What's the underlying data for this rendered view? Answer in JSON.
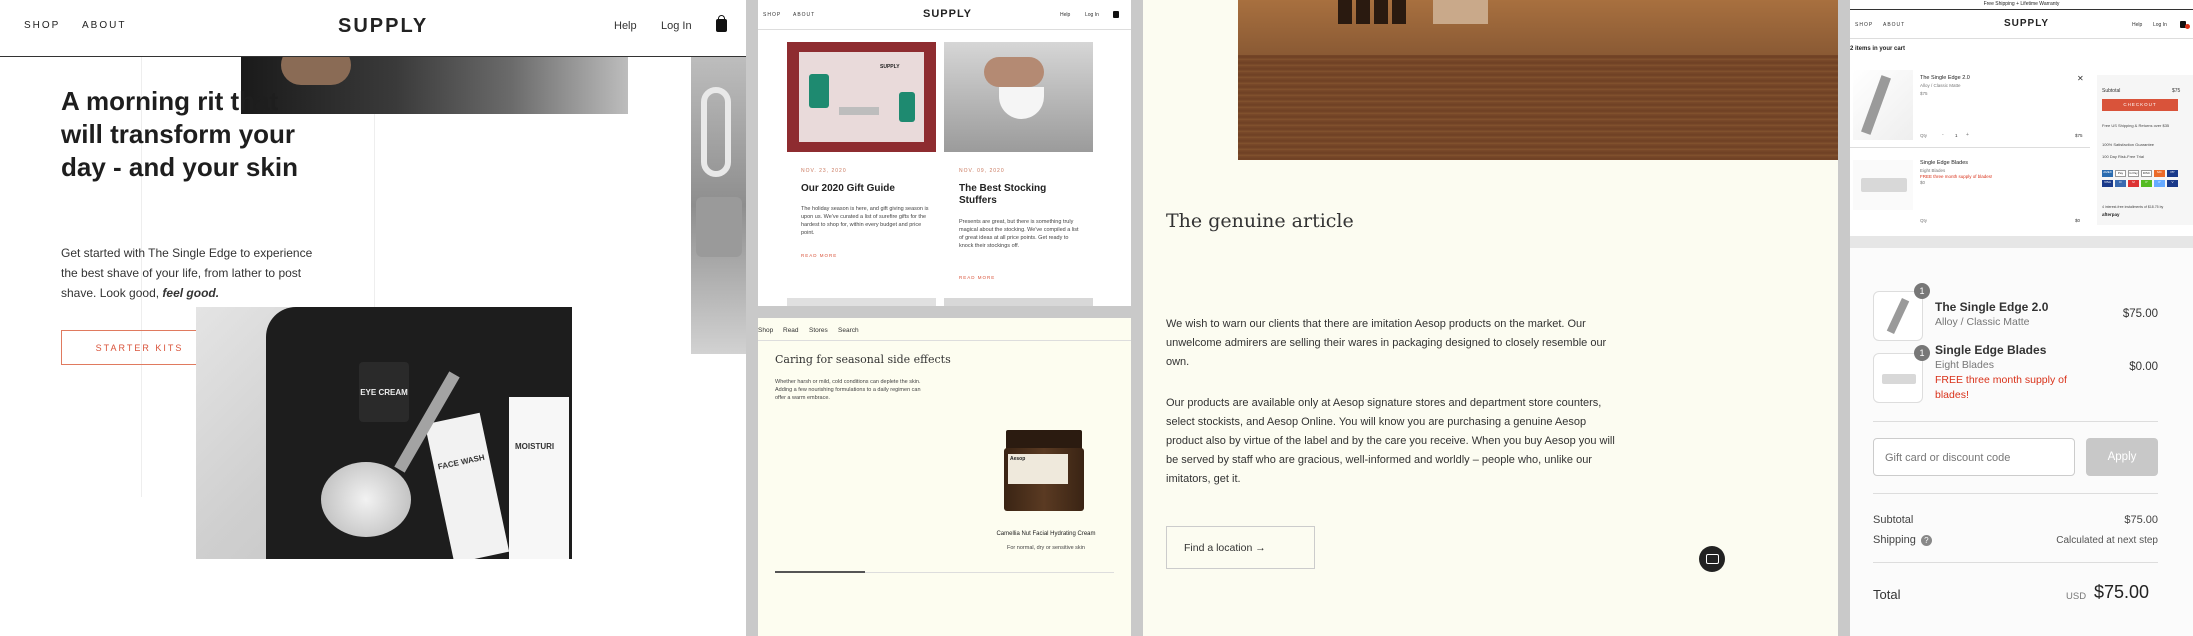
{
  "supply": {
    "nav": {
      "shop": "SHOP",
      "about": "ABOUT",
      "logo": "SUPPLY",
      "help": "Help",
      "login": "Log In"
    },
    "headline": "A morning rit that will transform your day - and your skin",
    "subtext_prefix": "Get started with The Single Edge to experience the best shave of your life, from lather to post shave. Look good, ",
    "subtext_emphasis": "feel good.",
    "cta": "STARTER KITS",
    "kit_labels": {
      "eye_cream": "EYE CREAM",
      "face_wash": "FACE WASH",
      "moisturizer": "MOISTURI"
    }
  },
  "blog": {
    "nav": {
      "shop": "SHOP",
      "about": "ABOUT",
      "logo": "SUPPLY",
      "help": "Help",
      "login": "Log In"
    },
    "cards": [
      {
        "date": "NOV. 23, 2020",
        "title": "Our 2020 Gift Guide",
        "body": "The holiday season is here, and gift giving season is upon us. We've curated a list of surefire gifts for the hardest to shop for, within every budget and price point.",
        "more": "READ MORE"
      },
      {
        "date": "NOV. 09, 2020",
        "title": "The Best Stocking Stuffers",
        "body": "Presents are great, but there is something truly magical about the stocking. We've compiled a list of great ideas at all price points. Get ready to knock their stockings off.",
        "more": "READ MORE"
      }
    ],
    "gift_box_label": "SUPPLY"
  },
  "aesop_small": {
    "nav": [
      "Shop",
      "Read",
      "Stores",
      "Search"
    ],
    "title": "Caring for seasonal side effects",
    "body": "Whether harsh or mild, cold conditions can deplete the skin. Adding a few nourishing formulations to a daily regimen can offer a warm embrace.",
    "product_name": "Camellia Nut Facial Hydrating Cream",
    "product_desc": "For normal, dry or sensitive skin",
    "jar_label": "Aesop"
  },
  "aesop_article": {
    "title": "The genuine article",
    "para1": "We wish to warn our clients that there are imitation Aesop products on the market. Our unwelcome admirers are selling their wares in packaging designed to closely resemble our own.",
    "para2": "Our products are available only at Aesop signature stores and department store counters, select stockists, and Aesop Online. You will know you are purchasing a genuine Aesop product also by virtue of the label and by the care you receive. When you buy Aesop you will be served by staff who are gracious, well-informed and worldly – people who, unlike our imitators, get it.",
    "cta": "Find a location →"
  },
  "cart_page": {
    "banner": "Free Shipping + Lifetime Warranty",
    "nav": {
      "shop": "SHOP",
      "about": "ABOUT",
      "logo": "SUPPLY",
      "help": "Help",
      "login": "Log In"
    },
    "items_heading": "2 items in your cart",
    "item1": {
      "name": "The Single Edge 2.0",
      "variant": "Alloy / Classic Matte",
      "price": "$75",
      "qty": "1",
      "qty_label": "Qty"
    },
    "item2": {
      "name": "Single Edge Blades",
      "variant": "Eight Blades",
      "promo": "FREE three month supply of blades!",
      "price": "$0",
      "qty_label": "Qty",
      "line_total": "$0"
    },
    "item1_line_total": "$75",
    "subtotal_label": "Subtotal",
    "subtotal": "$75",
    "checkout": "CHECKOUT",
    "perks": [
      "Free US Shipping & Returns over $35",
      "100% Satisfaction Guarantee",
      "100 Day Risk-Free Trial"
    ],
    "payment_icons": [
      "AMEX",
      "Pay",
      "G Pay",
      "DISC",
      "MC",
      "PP",
      "VISA",
      "D",
      "M",
      "P",
      "P",
      "V"
    ],
    "afterpay": "4 interest-free installments of $18.75 by",
    "afterpay_brand": "afterpay"
  },
  "checkout": {
    "items": [
      {
        "qty": "1",
        "name": "The Single Edge 2.0",
        "variant": "Alloy / Classic Matte",
        "price": "$75.00"
      },
      {
        "qty": "1",
        "name": "Single Edge Blades",
        "variant": "Eight Blades",
        "promo": "FREE three month supply of blades!",
        "price": "$0.00"
      }
    ],
    "gift_placeholder": "Gift card or discount code",
    "apply": "Apply",
    "subtotal_label": "Subtotal",
    "subtotal": "$75.00",
    "shipping_label": "Shipping",
    "shipping_help": "?",
    "shipping_value": "Calculated at next step",
    "total_label": "Total",
    "currency": "USD",
    "total": "$75.00"
  },
  "colors": {
    "accent": "#d9533a",
    "cream": "#fcfcf1",
    "dark": "#222222",
    "sale_red": "#d9321a"
  }
}
